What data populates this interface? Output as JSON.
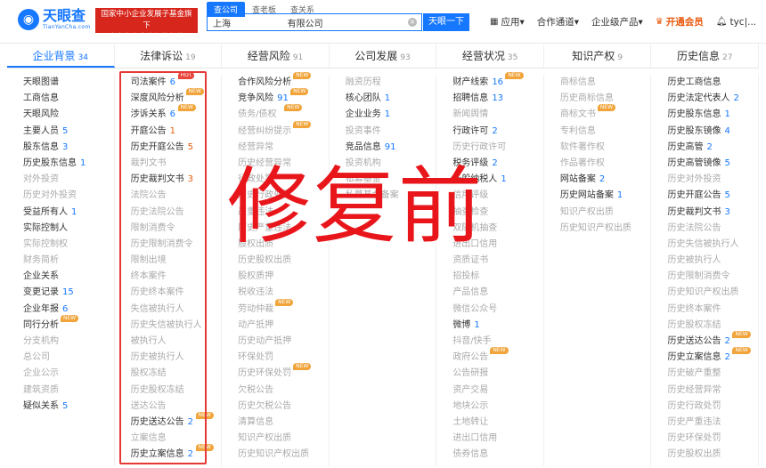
{
  "header": {
    "logo_cn": "天眼查",
    "logo_en": "TianYanCha.com",
    "badge_line1": "国家中小企业发展子基金旗下",
    "badge_line2": "官方备案企业征信机构",
    "search_tabs": [
      "查公司",
      "查老板",
      "查关系"
    ],
    "search_value": "上海                    有限公司",
    "search_button": "天眼一下",
    "nav": [
      "应用",
      "合作通道",
      "企业级产品",
      "开通会员",
      "tyc|..."
    ]
  },
  "columns": [
    {
      "label": "企业背景",
      "count": "34",
      "active": true
    },
    {
      "label": "法律诉讼",
      "count": "19",
      "active": false
    },
    {
      "label": "经营风险",
      "count": "91",
      "active": false
    },
    {
      "label": "公司发展",
      "count": "93",
      "active": false
    },
    {
      "label": "经营状况",
      "count": "35",
      "active": false
    },
    {
      "label": "知识产权",
      "count": "9",
      "active": false
    },
    {
      "label": "历史信息",
      "count": "27",
      "active": false
    }
  ],
  "lists": [
    [
      {
        "t": "天眼图谱"
      },
      {
        "t": "工商信息"
      },
      {
        "t": "天眼风险"
      },
      {
        "t": "主要人员",
        "n": "5"
      },
      {
        "t": "股东信息",
        "n": "3"
      },
      {
        "t": "历史股东信息",
        "n": "1"
      },
      {
        "t": "对外投资",
        "d": true
      },
      {
        "t": "历史对外投资",
        "d": true
      },
      {
        "t": "受益所有人",
        "n": "1"
      },
      {
        "t": "实际控制人"
      },
      {
        "t": "实际控制权",
        "d": true
      },
      {
        "t": "财务简析",
        "d": true
      },
      {
        "t": "企业关系"
      },
      {
        "t": "变更记录",
        "n": "15"
      },
      {
        "t": "企业年报",
        "n": "6"
      },
      {
        "t": "同行分析",
        "tag": "NEW"
      },
      {
        "t": "分支机构",
        "d": true
      },
      {
        "t": "总公司",
        "d": true
      },
      {
        "t": "企业公示",
        "d": true
      },
      {
        "t": "建筑资质",
        "d": true
      },
      {
        "t": "疑似关系",
        "n": "5"
      }
    ],
    [
      {
        "t": "司法案件",
        "n": "6",
        "tag": "HOT"
      },
      {
        "t": "深度风险分析",
        "tag": "NEW"
      },
      {
        "t": "涉诉关系",
        "n": "6",
        "tag": "NEW"
      },
      {
        "t": "开庭公告",
        "n": "1",
        "red": true
      },
      {
        "t": "历史开庭公告",
        "n": "5",
        "red": true
      },
      {
        "t": "裁判文书",
        "d": true
      },
      {
        "t": "历史裁判文书",
        "n": "3",
        "red": true
      },
      {
        "t": "法院公告",
        "d": true
      },
      {
        "t": "历史法院公告",
        "d": true
      },
      {
        "t": "限制消费令",
        "d": true
      },
      {
        "t": "历史限制消费令",
        "d": true
      },
      {
        "t": "限制出境",
        "d": true
      },
      {
        "t": "终本案件",
        "d": true
      },
      {
        "t": "历史终本案件",
        "d": true
      },
      {
        "t": "失信被执行人",
        "d": true
      },
      {
        "t": "历史失信被执行人",
        "d": true
      },
      {
        "t": "被执行人",
        "d": true
      },
      {
        "t": "历史被执行人",
        "d": true
      },
      {
        "t": "股权冻结",
        "d": true
      },
      {
        "t": "历史股权冻结",
        "d": true
      },
      {
        "t": "送达公告",
        "d": true
      },
      {
        "t": "历史送达公告",
        "n": "2",
        "tag": "NEW"
      },
      {
        "t": "立案信息",
        "d": true
      },
      {
        "t": "历史立案信息",
        "n": "2",
        "tag": "NEW"
      }
    ],
    [
      {
        "t": "合作风险分析",
        "tag": "NEW"
      },
      {
        "t": "竞争风险",
        "n": "91",
        "tag": "NEW"
      },
      {
        "t": "债务/债权",
        "d": true,
        "tag": "NEW"
      },
      {
        "t": "经营纠纷提示",
        "d": true,
        "tag": "NEW"
      },
      {
        "t": "经营异常",
        "d": true
      },
      {
        "t": "历史经营异常",
        "d": true
      },
      {
        "t": "行政处罚",
        "d": true
      },
      {
        "t": "历史行政处罚",
        "d": true
      },
      {
        "t": "严重违法",
        "d": true
      },
      {
        "t": "历史严重违法",
        "d": true
      },
      {
        "t": "股权出质",
        "d": true
      },
      {
        "t": "历史股权出质",
        "d": true
      },
      {
        "t": "股权质押",
        "d": true
      },
      {
        "t": "税收违法",
        "d": true
      },
      {
        "t": "劳动仲裁",
        "d": true,
        "tag": "NEW"
      },
      {
        "t": "动产抵押",
        "d": true
      },
      {
        "t": "历史动产抵押",
        "d": true
      },
      {
        "t": "环保处罚",
        "d": true
      },
      {
        "t": "历史环保处罚",
        "d": true,
        "tag": "NEW"
      },
      {
        "t": "欠税公告",
        "d": true
      },
      {
        "t": "历史欠税公告",
        "d": true
      },
      {
        "t": "清算信息",
        "d": true
      },
      {
        "t": "知识产权出质",
        "d": true
      },
      {
        "t": "历史知识产权出质",
        "d": true
      }
    ],
    [
      {
        "t": "融资历程",
        "d": true
      },
      {
        "t": "核心团队",
        "n": "1"
      },
      {
        "t": "企业业务",
        "n": "1"
      },
      {
        "t": "投资事件",
        "d": true
      },
      {
        "t": "竞品信息",
        "n": "91"
      },
      {
        "t": "投资机构",
        "d": true
      },
      {
        "t": "私募基金",
        "d": true
      },
      {
        "t": "私募基金备案",
        "d": true
      }
    ],
    [
      {
        "t": "财产线索",
        "n": "16",
        "tag": "NEW"
      },
      {
        "t": "招聘信息",
        "n": "13"
      },
      {
        "t": "新闻舆情",
        "d": true
      },
      {
        "t": "行政许可",
        "n": "2"
      },
      {
        "t": "历史行政许可",
        "d": true
      },
      {
        "t": "税务评级",
        "n": "2"
      },
      {
        "t": "一般纳税人",
        "n": "1"
      },
      {
        "t": "信用评级",
        "d": true
      },
      {
        "t": "抽查检查",
        "d": true
      },
      {
        "t": "双随机抽查",
        "d": true
      },
      {
        "t": "进出口信用",
        "d": true
      },
      {
        "t": "资质证书",
        "d": true
      },
      {
        "t": "招投标",
        "d": true
      },
      {
        "t": "产品信息",
        "d": true
      },
      {
        "t": "微信公众号",
        "d": true
      },
      {
        "t": "微博",
        "n": "1"
      },
      {
        "t": "抖音/快手",
        "d": true
      },
      {
        "t": "政府公告",
        "d": true,
        "tag": "NEW"
      },
      {
        "t": "公告研报",
        "d": true
      },
      {
        "t": "资产交易",
        "d": true
      },
      {
        "t": "地块公示",
        "d": true
      },
      {
        "t": "土地转让",
        "d": true
      },
      {
        "t": "进出口信用",
        "d": true
      },
      {
        "t": "债券信息",
        "d": true
      }
    ],
    [
      {
        "t": "商标信息",
        "d": true
      },
      {
        "t": "历史商标信息",
        "d": true
      },
      {
        "t": "商标文书",
        "d": true,
        "tag": "NEW"
      },
      {
        "t": "专利信息",
        "d": true
      },
      {
        "t": "软件著作权",
        "d": true
      },
      {
        "t": "作品著作权",
        "d": true
      },
      {
        "t": "网站备案",
        "n": "2"
      },
      {
        "t": "历史网站备案",
        "n": "1"
      },
      {
        "t": "知识产权出质",
        "d": true
      },
      {
        "t": "历史知识产权出质",
        "d": true
      }
    ],
    [
      {
        "t": "历史工商信息"
      },
      {
        "t": "历史法定代表人",
        "n": "2"
      },
      {
        "t": "历史股东信息",
        "n": "1"
      },
      {
        "t": "历史股东镜像",
        "n": "4"
      },
      {
        "t": "历史高管",
        "n": "2"
      },
      {
        "t": "历史高管镜像",
        "n": "5"
      },
      {
        "t": "历史对外投资",
        "d": true
      },
      {
        "t": "历史开庭公告",
        "n": "5"
      },
      {
        "t": "历史裁判文书",
        "n": "3"
      },
      {
        "t": "历史法院公告",
        "d": true
      },
      {
        "t": "历史失信被执行人",
        "d": true
      },
      {
        "t": "历史被执行人",
        "d": true
      },
      {
        "t": "历史限制消费令",
        "d": true
      },
      {
        "t": "历史知识产权出质",
        "d": true
      },
      {
        "t": "历史终本案件",
        "d": true
      },
      {
        "t": "历史股权冻结",
        "d": true
      },
      {
        "t": "历史送达公告",
        "n": "2",
        "tag": "NEW"
      },
      {
        "t": "历史立案信息",
        "n": "2",
        "tag": "NEW"
      },
      {
        "t": "历史破产重整",
        "d": true
      },
      {
        "t": "历史经营异常",
        "d": true
      },
      {
        "t": "历史行政处罚",
        "d": true
      },
      {
        "t": "历史严重违法",
        "d": true
      },
      {
        "t": "历史环保处罚",
        "d": true
      },
      {
        "t": "历史股权出质",
        "d": true
      }
    ]
  ],
  "overlay_text": "修复前"
}
